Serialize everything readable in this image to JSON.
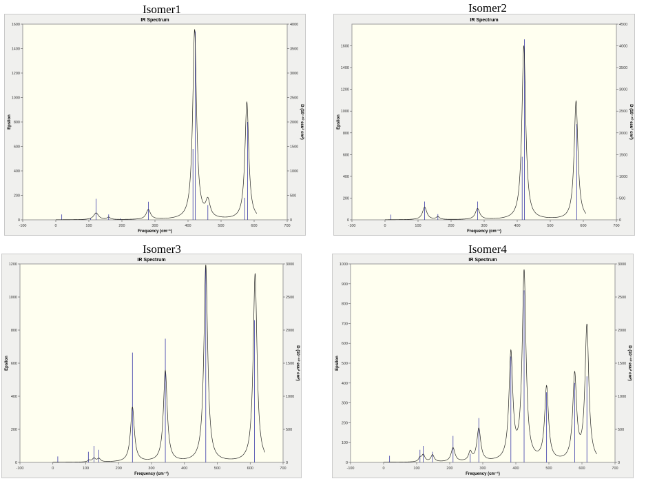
{
  "chart_data": [
    {
      "type": "line",
      "panel_title": "Isomer1",
      "title": "IR Spectrum",
      "xlabel": "Frequency (cm⁻¹)",
      "ylabel": "Epsilon",
      "y2label": "D (10⁻⁴⁰ esu² cm²)",
      "xlim": [
        -100,
        700
      ],
      "ylim": [
        0,
        1600
      ],
      "y2lim": [
        0,
        4000
      ],
      "xticks": [
        -100,
        0,
        100,
        200,
        300,
        400,
        500,
        600,
        700
      ],
      "yticks": [
        0,
        200,
        400,
        600,
        800,
        1000,
        1200,
        1400,
        1600
      ],
      "y2ticks": [
        0,
        500,
        1000,
        1500,
        2000,
        2500,
        3000,
        3500,
        4000
      ],
      "grid": false,
      "spectrum_peaks": [
        {
          "x": 122,
          "y": 55,
          "w": 9
        },
        {
          "x": 160,
          "y": 18,
          "w": 6
        },
        {
          "x": 280,
          "y": 80,
          "w": 8
        },
        {
          "x": 420,
          "y": 1550,
          "w": 7
        },
        {
          "x": 460,
          "y": 135,
          "w": 8
        },
        {
          "x": 578,
          "y": 960,
          "w": 7
        }
      ],
      "sticks": [
        {
          "x": 18,
          "d": 110
        },
        {
          "x": 105,
          "d": 30
        },
        {
          "x": 122,
          "d": 430
        },
        {
          "x": 160,
          "d": 110
        },
        {
          "x": 195,
          "d": 30
        },
        {
          "x": 280,
          "d": 370
        },
        {
          "x": 415,
          "d": 1450
        },
        {
          "x": 422,
          "d": 3850
        },
        {
          "x": 460,
          "d": 300
        },
        {
          "x": 572,
          "d": 450
        },
        {
          "x": 580,
          "d": 2000
        }
      ]
    },
    {
      "type": "line",
      "panel_title": "Isomer2",
      "title": "IR Spectrum",
      "xlabel": "Frequency (cm⁻¹)",
      "ylabel": "Epsilon",
      "y2label": "D (10⁻⁴⁰ esu² cm²)",
      "xlim": [
        -100,
        700
      ],
      "ylim": [
        0,
        1800
      ],
      "y2lim": [
        0,
        4500
      ],
      "xticks": [
        -100,
        0,
        100,
        200,
        300,
        400,
        500,
        600,
        700
      ],
      "yticks": [
        0,
        200,
        400,
        600,
        800,
        1000,
        1200,
        1400,
        1600
      ],
      "y2ticks": [
        0,
        500,
        1000,
        1500,
        2000,
        2500,
        3000,
        3500,
        4000,
        4500
      ],
      "grid": false,
      "spectrum_peaks": [
        {
          "x": 120,
          "y": 115,
          "w": 8
        },
        {
          "x": 160,
          "y": 25,
          "w": 6
        },
        {
          "x": 280,
          "y": 100,
          "w": 8
        },
        {
          "x": 420,
          "y": 1600,
          "w": 7
        },
        {
          "x": 578,
          "y": 1090,
          "w": 7
        }
      ],
      "sticks": [
        {
          "x": 18,
          "d": 120
        },
        {
          "x": 120,
          "d": 420
        },
        {
          "x": 160,
          "d": 130
        },
        {
          "x": 280,
          "d": 420
        },
        {
          "x": 415,
          "d": 1450
        },
        {
          "x": 422,
          "d": 4150
        },
        {
          "x": 580,
          "d": 2200
        }
      ]
    },
    {
      "type": "line",
      "panel_title": "Isomer3",
      "title": "IR Spectrum",
      "xlabel": "Frequency (cm⁻¹)",
      "ylabel": "Epsilon",
      "y2label": "D (10⁻⁴⁰ esu² cm²)",
      "xlim": [
        -100,
        700
      ],
      "ylim": [
        0,
        1200
      ],
      "y2lim": [
        0,
        3000
      ],
      "xticks": [
        -100,
        0,
        100,
        200,
        300,
        400,
        500,
        600,
        700
      ],
      "yticks": [
        0,
        200,
        400,
        600,
        800,
        1000,
        1200
      ],
      "y2ticks": [
        0,
        500,
        1000,
        1500,
        2000,
        2500,
        3000
      ],
      "grid": false,
      "spectrum_peaks": [
        {
          "x": 110,
          "y": 10,
          "w": 5
        },
        {
          "x": 125,
          "y": 22,
          "w": 6
        },
        {
          "x": 140,
          "y": 20,
          "w": 6
        },
        {
          "x": 242,
          "y": 330,
          "w": 7
        },
        {
          "x": 342,
          "y": 550,
          "w": 7
        },
        {
          "x": 465,
          "y": 1190,
          "w": 7
        },
        {
          "x": 615,
          "y": 1140,
          "w": 7
        }
      ],
      "sticks": [
        {
          "x": 15,
          "d": 90
        },
        {
          "x": 108,
          "d": 160
        },
        {
          "x": 125,
          "d": 250
        },
        {
          "x": 140,
          "d": 190
        },
        {
          "x": 242,
          "d": 1660
        },
        {
          "x": 342,
          "d": 1870
        },
        {
          "x": 465,
          "d": 2950
        },
        {
          "x": 613,
          "d": 2150
        }
      ]
    },
    {
      "type": "line",
      "panel_title": "Isomer4",
      "title": "IR Spectrum",
      "xlabel": "Frequency (cm⁻¹)",
      "ylabel": "Epsilon",
      "y2label": "D (10⁻⁴⁰ esu² cm²)",
      "xlim": [
        -100,
        700
      ],
      "ylim": [
        0,
        1000
      ],
      "y2lim": [
        0,
        3000
      ],
      "xticks": [
        -100,
        0,
        100,
        200,
        300,
        400,
        500,
        600,
        700
      ],
      "yticks": [
        0,
        100,
        200,
        300,
        400,
        500,
        600,
        700,
        800,
        900,
        1000
      ],
      "y2ticks": [
        0,
        500,
        1000,
        1500,
        2000,
        2500,
        3000
      ],
      "grid": false,
      "spectrum_peaks": [
        {
          "x": 110,
          "y": 18,
          "w": 5
        },
        {
          "x": 120,
          "y": 35,
          "w": 6
        },
        {
          "x": 148,
          "y": 35,
          "w": 6
        },
        {
          "x": 210,
          "y": 70,
          "w": 7
        },
        {
          "x": 262,
          "y": 45,
          "w": 6
        },
        {
          "x": 288,
          "y": 165,
          "w": 7
        },
        {
          "x": 385,
          "y": 535,
          "w": 7
        },
        {
          "x": 425,
          "y": 950,
          "w": 7
        },
        {
          "x": 493,
          "y": 370,
          "w": 7
        },
        {
          "x": 578,
          "y": 430,
          "w": 7
        },
        {
          "x": 615,
          "y": 680,
          "w": 7
        }
      ],
      "sticks": [
        {
          "x": 18,
          "d": 100
        },
        {
          "x": 110,
          "d": 190
        },
        {
          "x": 120,
          "d": 250
        },
        {
          "x": 148,
          "d": 160
        },
        {
          "x": 210,
          "d": 400
        },
        {
          "x": 262,
          "d": 130
        },
        {
          "x": 288,
          "d": 670
        },
        {
          "x": 385,
          "d": 1600
        },
        {
          "x": 425,
          "d": 2600
        },
        {
          "x": 493,
          "d": 1060
        },
        {
          "x": 578,
          "d": 1200
        },
        {
          "x": 615,
          "d": 1300
        }
      ]
    }
  ]
}
